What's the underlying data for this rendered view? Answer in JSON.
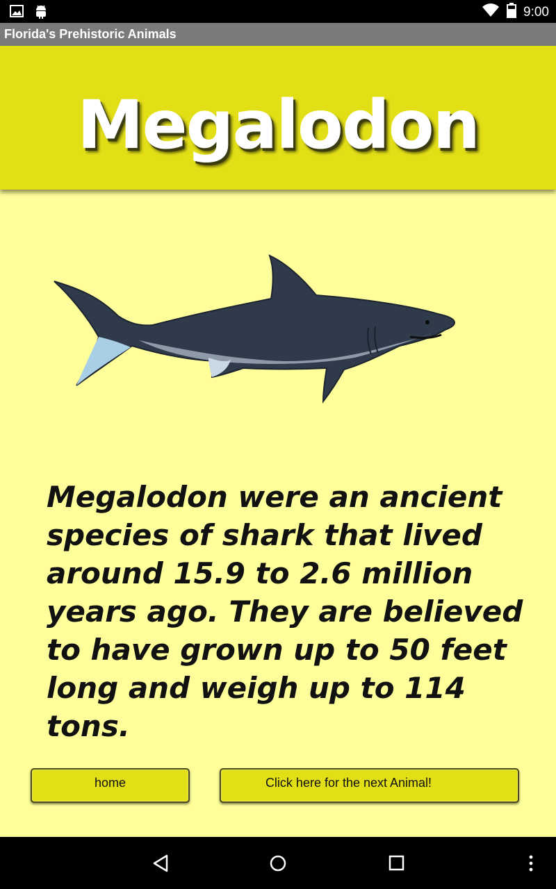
{
  "status_bar": {
    "time": "9:00",
    "left_icons": [
      "image-icon",
      "android-icon"
    ],
    "right_icons": [
      "wifi-icon",
      "battery-icon"
    ]
  },
  "app": {
    "title": "Florida's Prehistoric Animals"
  },
  "banner": {
    "title": "Megalodon",
    "background": "#e3df17"
  },
  "illustration": {
    "icon": "shark-illustration"
  },
  "content": {
    "description": "Megalodon were an ancient species of shark that lived around 15.9 to 2.6 million years ago. They are believed to have grown up to 50 feet long and weigh up to 114 tons."
  },
  "buttons": {
    "home_label": "home",
    "next_label": "Click here for the next Animal!"
  },
  "nav_bar": {
    "icons": [
      "back-icon",
      "home-icon",
      "recents-icon",
      "menu-icon"
    ]
  },
  "colors": {
    "background": "#fefe9a",
    "accent": "#e3df17",
    "title_bar": "#7b7b7b"
  }
}
